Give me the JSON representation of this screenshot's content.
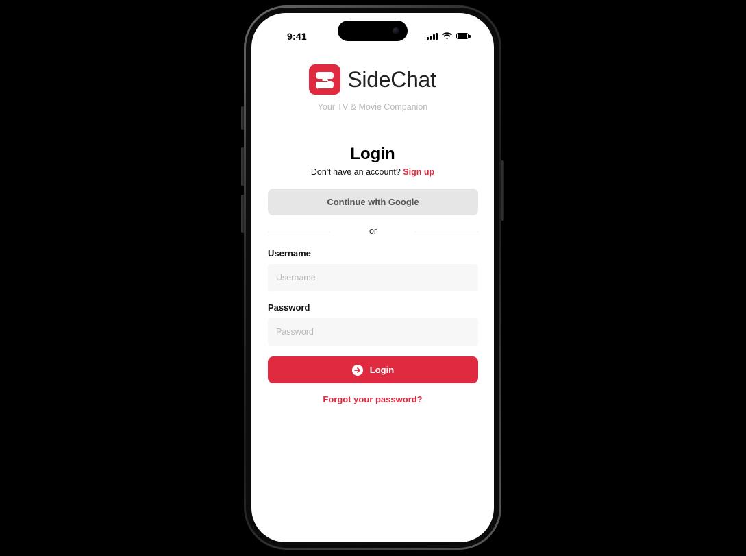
{
  "status_bar": {
    "time": "9:41",
    "icons": [
      "cellular-signal-icon",
      "wifi-icon",
      "battery-icon"
    ]
  },
  "brand": {
    "name": "SideChat",
    "tagline": "Your TV & Movie Companion",
    "logo_icon": "sidechat-logo-icon",
    "accent_color": "#e02a3f"
  },
  "login": {
    "title": "Login",
    "signup_prompt": "Don't have an account?",
    "signup_link": "Sign up",
    "google_button": "Continue with Google",
    "divider_text": "or",
    "username_label": "Username",
    "username_placeholder": "Username",
    "password_label": "Password",
    "password_placeholder": "Password",
    "submit_label": "Login",
    "submit_icon": "arrow-right-circle-icon",
    "forgot_link": "Forgot your password?"
  }
}
